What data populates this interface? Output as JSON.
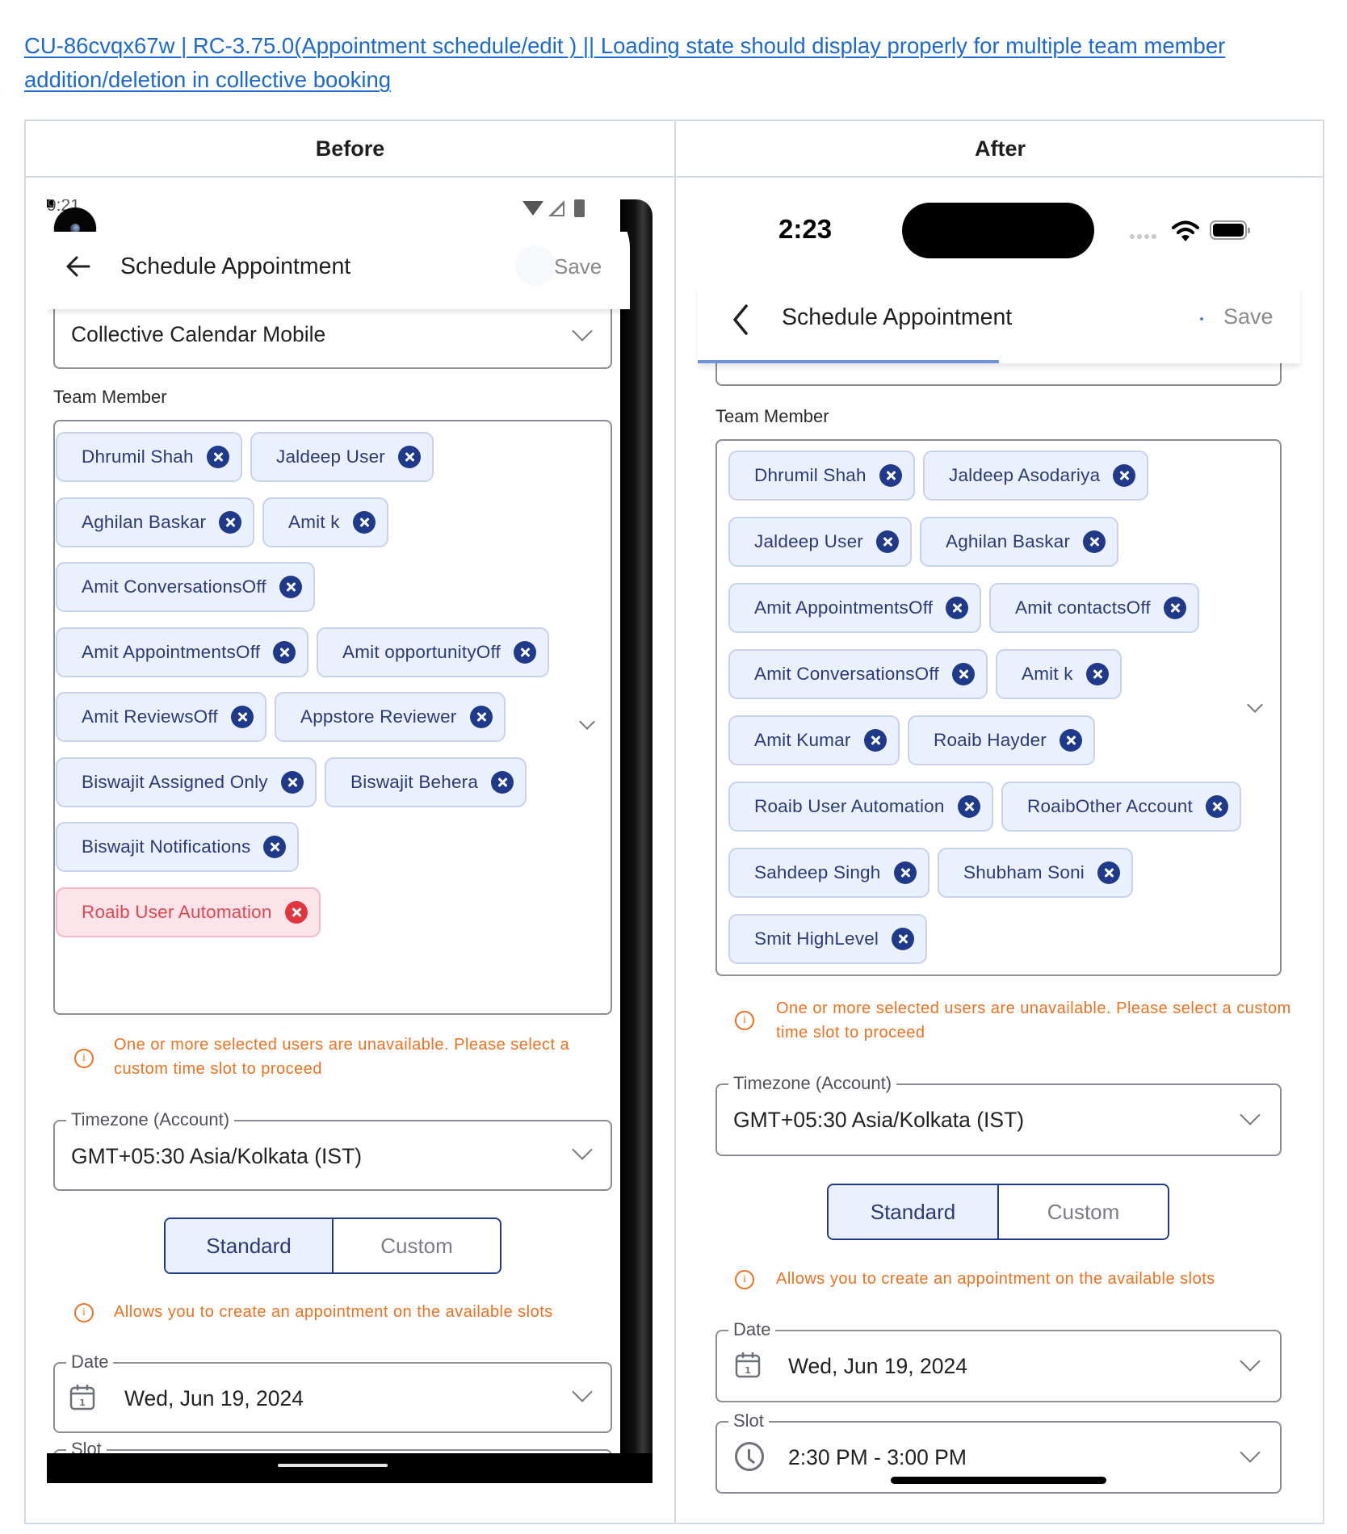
{
  "ticket_link": "CU-86cvqx67w | RC-3.75.0(Appointment schedule/edit ) || Loading state should display properly for multiple team member addition/deletion in collective booking",
  "table": {
    "headers": [
      "Before",
      "After"
    ]
  },
  "before": {
    "status_bar": {
      "time": "9:21",
      "icons": [
        "wifi-icon",
        "signal-icon",
        "battery-icon"
      ]
    },
    "header": {
      "back_icon": "arrow-left-icon",
      "title": "Schedule Appointment",
      "save_label": "Save"
    },
    "calendar_field": {
      "value": "Collective Calendar Mobile"
    },
    "team_member_label": "Team Member",
    "team_members": [
      {
        "name": "Dhrumil Shah",
        "state": "normal"
      },
      {
        "name": "Jaldeep User",
        "state": "normal"
      },
      {
        "name": "Aghilan Baskar",
        "state": "normal"
      },
      {
        "name": "Amit k",
        "state": "normal"
      },
      {
        "name": "Amit ConversationsOff",
        "state": "normal"
      },
      {
        "name": "Amit AppointmentsOff",
        "state": "normal"
      },
      {
        "name": "Amit opportunityOff",
        "state": "normal"
      },
      {
        "name": "Amit ReviewsOff",
        "state": "normal"
      },
      {
        "name": "Appstore Reviewer",
        "state": "normal"
      },
      {
        "name": "Biswajit Assigned Only",
        "state": "normal"
      },
      {
        "name": "Biswajit Behera",
        "state": "normal"
      },
      {
        "name": "Biswajit Notifications",
        "state": "normal"
      },
      {
        "name": "Roaib User Automation",
        "state": "unavailable"
      }
    ],
    "warning": "One or more selected users are unavailable. Please select a custom time slot to proceed",
    "timezone": {
      "label": "Timezone (Account)",
      "value": "GMT+05:30 Asia/Kolkata (IST)"
    },
    "mode_toggle": {
      "options": [
        "Standard",
        "Custom"
      ],
      "selected": "Standard"
    },
    "info": "Allows you to create an appointment on the available slots",
    "date": {
      "label": "Date",
      "value": "Wed, Jun 19, 2024"
    },
    "slot": {
      "label": "Slot"
    }
  },
  "after": {
    "status_bar": {
      "time": "2:23",
      "icons": [
        "signal-dots-icon",
        "wifi-icon",
        "battery-icon"
      ]
    },
    "header": {
      "back_icon": "chevron-left-icon",
      "title": "Schedule Appointment",
      "save_label": "Save",
      "loading_progress": 0.5
    },
    "team_member_label": "Team Member",
    "team_members": [
      {
        "name": "Dhrumil Shah",
        "state": "normal"
      },
      {
        "name": "Jaldeep Asodariya",
        "state": "normal"
      },
      {
        "name": "Jaldeep User",
        "state": "normal"
      },
      {
        "name": "Aghilan Baskar",
        "state": "normal"
      },
      {
        "name": "Amit AppointmentsOff",
        "state": "normal"
      },
      {
        "name": "Amit contactsOff",
        "state": "normal"
      },
      {
        "name": "Amit ConversationsOff",
        "state": "normal"
      },
      {
        "name": "Amit k",
        "state": "normal"
      },
      {
        "name": "Amit Kumar",
        "state": "normal"
      },
      {
        "name": "Roaib Hayder",
        "state": "normal"
      },
      {
        "name": "Roaib User Automation",
        "state": "normal"
      },
      {
        "name": "RoaibOther Account",
        "state": "normal"
      },
      {
        "name": "Sahdeep Singh",
        "state": "normal"
      },
      {
        "name": "Shubham  Soni",
        "state": "normal"
      },
      {
        "name": "Smit HighLevel",
        "state": "normal"
      }
    ],
    "warning": "One or more selected users are unavailable. Please select a custom time slot to proceed",
    "timezone": {
      "label": "Timezone (Account)",
      "value": "GMT+05:30 Asia/Kolkata (IST)"
    },
    "mode_toggle": {
      "options": [
        "Standard",
        "Custom"
      ],
      "selected": "Standard"
    },
    "info": "Allows you to create an appointment on the available slots",
    "date": {
      "label": "Date",
      "value": "Wed, Jun 19, 2024"
    },
    "slot": {
      "label": "Slot",
      "value": "2:30 PM - 3:00 PM"
    }
  },
  "colors": {
    "link": "#1b69d1",
    "chip_bg": "#ebf0fd",
    "chip_text": "#2a3a7a",
    "chip_remove": "#1f3a8a",
    "chip_error_bg": "#fde4ea",
    "chip_error_text": "#e2464f",
    "warning": "#f0701e",
    "progress": "#6d93e0"
  }
}
